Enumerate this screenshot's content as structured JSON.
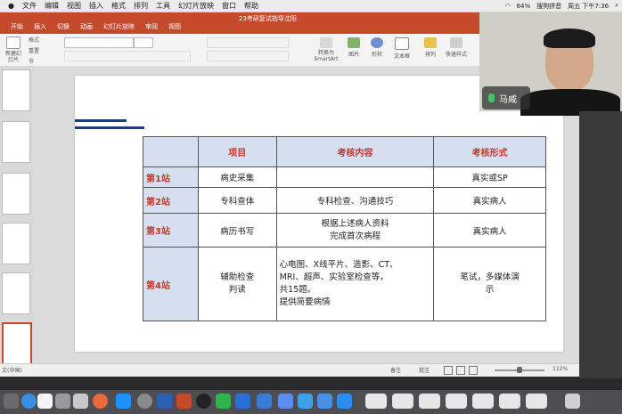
{
  "menubar": {
    "items": [
      "文件",
      "编辑",
      "视图",
      "插入",
      "格式",
      "排列",
      "工具",
      "幻灯片放映",
      "窗口",
      "帮助"
    ],
    "status": {
      "battery": "64%",
      "input_method": "搜狗拼音",
      "clock": "周五 下午7:36"
    }
  },
  "window": {
    "title": "23考研复试指导沈阳",
    "tabs": [
      "开始",
      "插入",
      "切换",
      "动画",
      "幻灯片放映",
      "审阅",
      "视图"
    ]
  },
  "toolbar": {
    "new_slide": "新建幻灯片",
    "format": "格式",
    "reset": "重置",
    "section": "节",
    "convert_smartart": "转换为SmartArt",
    "picture": "图片",
    "shape": "形状",
    "textbox": "文本框",
    "arrange": "排列",
    "quick_style": "快速样式"
  },
  "slide": {
    "table": {
      "headers": [
        "项目",
        "考核内容",
        "考核形式"
      ],
      "rows": [
        {
          "station": "第1站",
          "item": "病史采集",
          "content": "",
          "form": "真实或SP"
        },
        {
          "station": "第2站",
          "item": "专科查体",
          "content": "专科检查、沟通技巧",
          "form": "真实病人"
        },
        {
          "station": "第3站",
          "item": "病历书写",
          "content": "根据上述病人资料\n完成首次病程",
          "form": "真实病人"
        },
        {
          "station": "第4站",
          "item": "辅助检查\n判读",
          "content": "心电图、X线平片、造影、CT、\nMRI、超声、实验室检查等，\n共15题。\n提供简要病情",
          "form": "笔试，多媒体演\n示"
        }
      ]
    }
  },
  "statusbar": {
    "lang": "文(中国)",
    "notes": "备注",
    "comments": "批注",
    "zoom": "112%"
  },
  "video": {
    "participant_name": "马威"
  },
  "colors": {
    "accent": "#c54a2c",
    "header_fill": "#d5dff0",
    "station_text": "#c0392b",
    "bar": "#1f3d7a"
  }
}
